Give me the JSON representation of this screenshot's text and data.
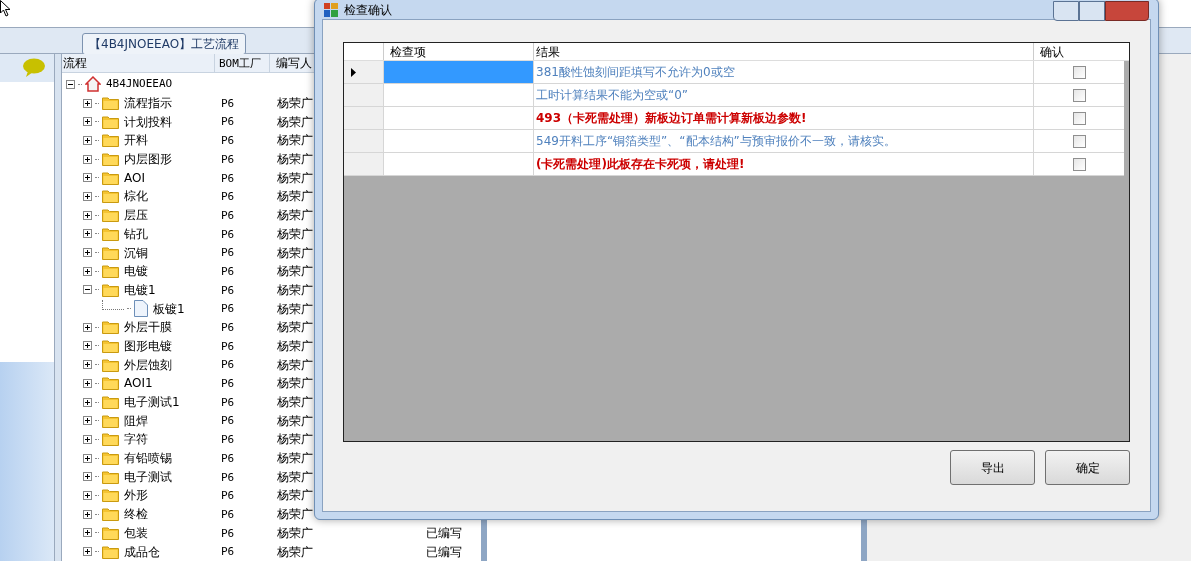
{
  "app": {
    "tab": "【4B4JNOEEAO】工艺流程",
    "tree": {
      "columns": [
        "流程",
        "BOM工厂",
        "编写人"
      ],
      "nodes": [
        {
          "label": "4B4JNOEEAO",
          "kind": "home",
          "expanded": true,
          "children": [
            {
              "label": "流程指示",
              "kind": "folder",
              "expanded": false,
              "factory": "P6",
              "author": "杨荣广"
            },
            {
              "label": "计划投料",
              "kind": "folder",
              "expanded": false,
              "factory": "P6",
              "author": "杨荣广"
            },
            {
              "label": "开料",
              "kind": "folder",
              "expanded": false,
              "factory": "P6",
              "author": "杨荣广"
            },
            {
              "label": "内层图形",
              "kind": "folder",
              "expanded": false,
              "factory": "P6",
              "author": "杨荣广"
            },
            {
              "label": "AOI",
              "kind": "folder",
              "expanded": false,
              "factory": "P6",
              "author": "杨荣广"
            },
            {
              "label": "棕化",
              "kind": "folder",
              "expanded": false,
              "factory": "P6",
              "author": "杨荣广"
            },
            {
              "label": "层压",
              "kind": "folder",
              "expanded": false,
              "factory": "P6",
              "author": "杨荣广"
            },
            {
              "label": "钻孔",
              "kind": "folder",
              "expanded": false,
              "factory": "P6",
              "author": "杨荣广"
            },
            {
              "label": "沉铜",
              "kind": "folder",
              "expanded": false,
              "factory": "P6",
              "author": "杨荣广"
            },
            {
              "label": "电镀",
              "kind": "folder",
              "expanded": false,
              "factory": "P6",
              "author": "杨荣广"
            },
            {
              "label": "电镀1",
              "kind": "folder",
              "expanded": true,
              "factory": "P6",
              "author": "杨荣广",
              "children": [
                {
                  "label": "板镀1",
                  "kind": "file",
                  "factory": "P6",
                  "author": "杨荣广"
                }
              ]
            },
            {
              "label": "外层干膜",
              "kind": "folder",
              "expanded": false,
              "factory": "P6",
              "author": "杨荣广"
            },
            {
              "label": "图形电镀",
              "kind": "folder",
              "expanded": false,
              "factory": "P6",
              "author": "杨荣广"
            },
            {
              "label": "外层蚀刻",
              "kind": "folder",
              "expanded": false,
              "factory": "P6",
              "author": "杨荣广"
            },
            {
              "label": "AOI1",
              "kind": "folder",
              "expanded": false,
              "factory": "P6",
              "author": "杨荣广"
            },
            {
              "label": "电子测试1",
              "kind": "folder",
              "expanded": false,
              "factory": "P6",
              "author": "杨荣广"
            },
            {
              "label": "阻焊",
              "kind": "folder",
              "expanded": false,
              "factory": "P6",
              "author": "杨荣广"
            },
            {
              "label": "字符",
              "kind": "folder",
              "expanded": false,
              "factory": "P6",
              "author": "杨荣广"
            },
            {
              "label": "有铅喷锡",
              "kind": "folder",
              "expanded": false,
              "factory": "P6",
              "author": "杨荣广"
            },
            {
              "label": "电子测试",
              "kind": "folder",
              "expanded": false,
              "factory": "P6",
              "author": "杨荣广"
            },
            {
              "label": "外形",
              "kind": "folder",
              "expanded": false,
              "factory": "P6",
              "author": "杨荣广"
            },
            {
              "label": "终检",
              "kind": "folder",
              "expanded": false,
              "factory": "P6",
              "author": "杨荣广"
            },
            {
              "label": "包装",
              "kind": "folder",
              "expanded": false,
              "factory": "P6",
              "author": "杨荣广",
              "status": "已编写"
            },
            {
              "label": "成品仓",
              "kind": "folder",
              "expanded": false,
              "factory": "P6",
              "author": "杨荣广",
              "status": "已编写"
            }
          ]
        }
      ]
    }
  },
  "dialog": {
    "title": "检查确认",
    "columns": [
      "检查项",
      "结果",
      "确认"
    ],
    "rows": [
      {
        "item": "",
        "result": "381酸性蚀刻间距填写不允许为0或空",
        "kind": "info",
        "checked": false,
        "selected": true
      },
      {
        "item": "",
        "result": "工时计算结果不能为空或“0”",
        "kind": "info",
        "checked": false,
        "selected": false
      },
      {
        "item": "",
        "result": "493（卡死需处理）新板边订单需计算新板边参数!",
        "kind": "blocking",
        "checked": false,
        "selected": false
      },
      {
        "item": "",
        "result": "549开料工序“铜箔类型”、“配本结构”与预审报价不一致，请核实。",
        "kind": "info",
        "checked": false,
        "selected": false
      },
      {
        "item": "",
        "result": "(卡死需处理)此板存在卡死项，请处理!",
        "kind": "blocking",
        "checked": false,
        "selected": false
      }
    ],
    "buttons": [
      "导出",
      "确定"
    ]
  }
}
